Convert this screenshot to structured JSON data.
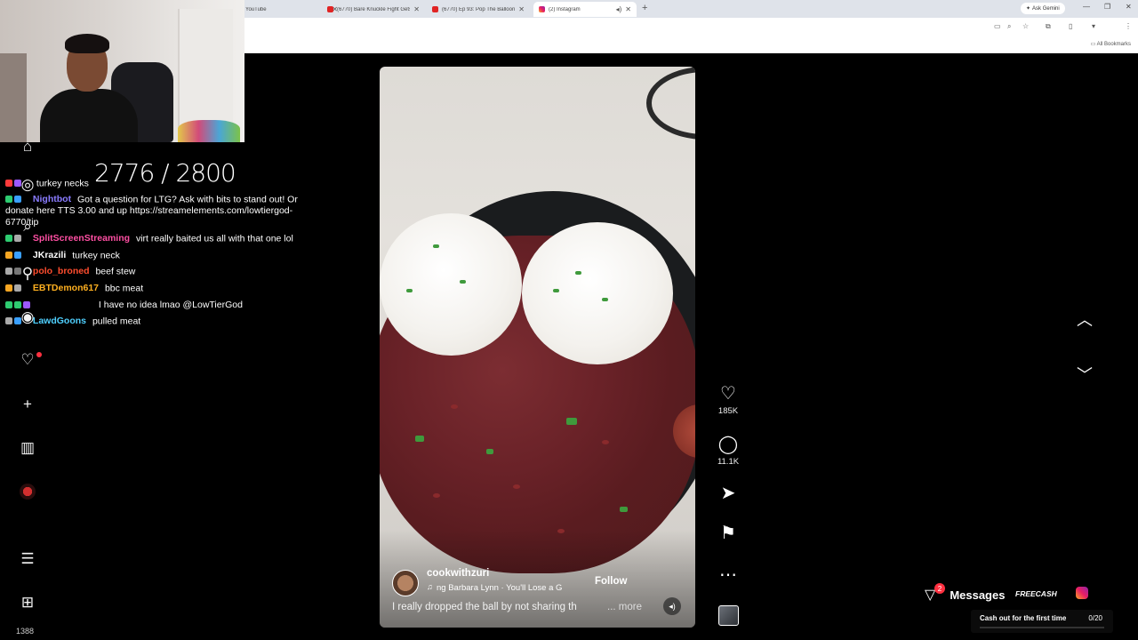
{
  "browser": {
    "tabs": [
      {
        "title": "YouTube",
        "favicon": "youtube-icon",
        "active": false
      },
      {
        "title": "(6770) Bare Knuckle Fight Gets",
        "favicon": "youtube-icon",
        "active": false
      },
      {
        "title": "(6770) Ep 93: Pop The Balloon",
        "favicon": "youtube-icon",
        "active": false
      },
      {
        "title": "(2) Instagram",
        "favicon": "instagram-icon",
        "active": true
      }
    ],
    "new_tab": "+",
    "ask_gemini": "Ask Gemini",
    "all_bookmarks": "All Bookmarks"
  },
  "stream": {
    "counter": "2776 / 2800",
    "chat": [
      {
        "user": "",
        "message": "turkey necks",
        "user_color": "#7b68ee"
      },
      {
        "user": "Nightbot",
        "message": "Got a question for LTG? Ask with bits to stand out! Or donate here TTS 3.00 and up https://streamelements.com/lowtiergod-6770/tip",
        "user_color": "#8a7cff"
      },
      {
        "user": "SplitScreenStreaming",
        "message": "virt really baited us all with that one lol",
        "user_color": "#ff4fa3"
      },
      {
        "user": "JKrazili",
        "message": "turkey neck",
        "user_color": "#ffffff"
      },
      {
        "user": "polo_broned",
        "message": "beef stew",
        "user_color": "#ff4d2e"
      },
      {
        "user": "EBTDemon617",
        "message": "bbc meat",
        "user_color": "#ffb020"
      },
      {
        "user": "",
        "message": "I have no idea lmao @LowTierGod",
        "user_color": "#3b6cff"
      },
      {
        "user": "LawdGoons",
        "message": "pulled meat",
        "user_color": "#4fd0ff"
      }
    ]
  },
  "sidebar": {
    "count": "1388"
  },
  "reel": {
    "username": "cookwithzuri",
    "follow": "Follow",
    "audio": "ng  Barbara Lynn · You'll Lose a G",
    "caption": "I really dropped the ball by not sharing th",
    "more": "... more",
    "likes": "185K",
    "comments": "11.1K"
  },
  "messages": {
    "label": "Messages",
    "badge": "2"
  },
  "promo": {
    "brand": "FREECASH",
    "text": "Cash out for the first time",
    "count": "0/20"
  },
  "colors": {
    "like_badge": "#ff3040",
    "instagram_gradient": [
      "#f9a825",
      "#e91e63",
      "#8e24aa"
    ]
  }
}
